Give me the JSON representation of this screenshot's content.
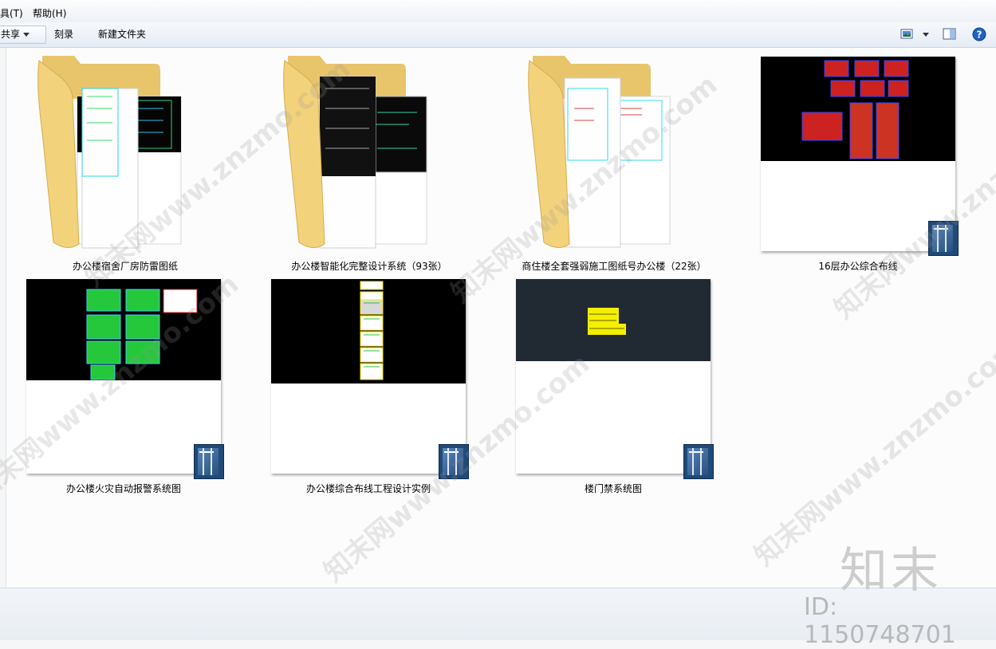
{
  "menu": {
    "tools": "具(T)",
    "help": "帮助(H)"
  },
  "toolbar": {
    "share": "共享",
    "burn": "刻录",
    "new_folder": "新建文件夹"
  },
  "items": [
    {
      "name": "办公楼宿舍厂房防雷图纸",
      "type": "folder"
    },
    {
      "name": "办公楼智能化完整设计系统（93张）",
      "type": "folder"
    },
    {
      "name": "商住楼全套强弱施工图纸号办公楼（22张）",
      "type": "folder"
    },
    {
      "name": "16层办公综合布线",
      "type": "dwg"
    },
    {
      "name": "办公楼火灾自动报警系统图",
      "type": "dwg"
    },
    {
      "name": "办公楼综合布线工程设计实例",
      "type": "dwg"
    },
    {
      "name": "楼门禁系统图",
      "type": "dwg"
    }
  ],
  "watermark": {
    "text": "知末网www.znzmo.com",
    "brand": "知末",
    "id": "ID: 1150748701"
  },
  "icons": [
    "view-options-icon",
    "preview-pane-icon",
    "help-icon",
    "folder-icon",
    "dwg-file-icon"
  ]
}
